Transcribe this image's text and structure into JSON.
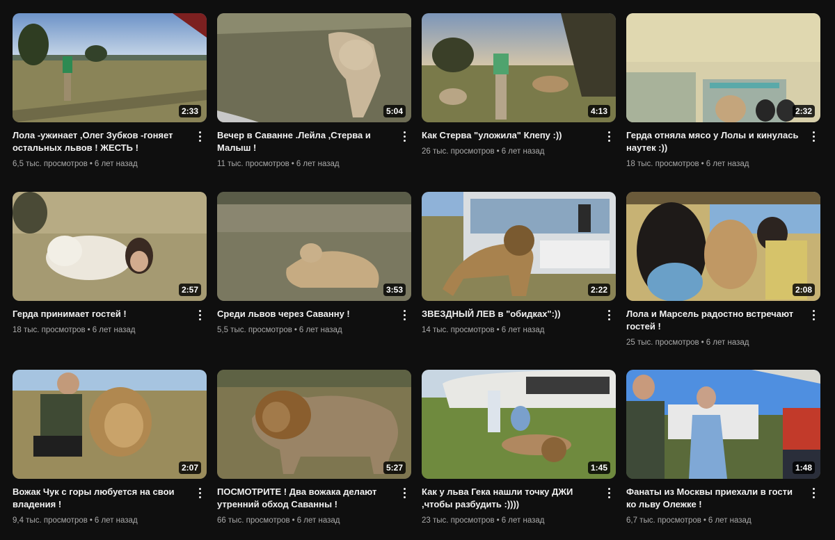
{
  "videos": [
    {
      "title": "Лола -ужинает ,Олег Зубков -гоняет остальных львов ! ЖЕСТЬ !",
      "duration": "2:33",
      "views": "6,5 тыс. просмотров",
      "age": "6 лет назад"
    },
    {
      "title": "Вечер в Саванне .Лейла ,Стерва и Малыш !",
      "duration": "5:04",
      "views": "11 тыс. просмотров",
      "age": "6 лет назад"
    },
    {
      "title": "Как Стерва \"уложила\" Клепу :))",
      "duration": "4:13",
      "views": "26 тыс. просмотров",
      "age": "6 лет назад"
    },
    {
      "title": "Герда отняла мясо у Лолы и кинулась наутек :))",
      "duration": "2:32",
      "views": "18 тыс. просмотров",
      "age": "6 лет назад"
    },
    {
      "title": "Герда принимает гостей !",
      "duration": "2:57",
      "views": "18 тыс. просмотров",
      "age": "6 лет назад"
    },
    {
      "title": "Среди львов через Саванну !",
      "duration": "3:53",
      "views": "5,5 тыс. просмотров",
      "age": "6 лет назад"
    },
    {
      "title": "ЗВЕЗДНЫЙ ЛЕВ в \"обидках\":))",
      "duration": "2:22",
      "views": "14 тыс. просмотров",
      "age": "6 лет назад"
    },
    {
      "title": "Лола и Марсель радостно встречают гостей !",
      "duration": "2:08",
      "views": "25 тыс. просмотров",
      "age": "6 лет назад"
    },
    {
      "title": "Вожак Чук с горы любуется на свои владения !",
      "duration": "2:07",
      "views": "9,4 тыс. просмотров",
      "age": "6 лет назад"
    },
    {
      "title": "ПОСМОТРИТЕ ! Два вожака делают утренний обход Саванны !",
      "duration": "5:27",
      "views": "66 тыс. просмотров",
      "age": "6 лет назад"
    },
    {
      "title": "Как у льва Гека нашли точку ДЖИ ,чтобы разбудить :))))",
      "duration": "1:45",
      "views": "23 тыс. просмотров",
      "age": "6 лет назад"
    },
    {
      "title": "Фанаты из Москвы приехали в гости ко льву Олежке !",
      "duration": "1:48",
      "views": "6,7 тыс. просмотров",
      "age": "6 лет назад"
    }
  ],
  "separator": "•",
  "icons": {
    "menu": "kebab-vertical-icon"
  },
  "colors": {
    "background": "#0f0f0f",
    "title": "#f1f1f1",
    "meta": "#aaaaaa"
  }
}
